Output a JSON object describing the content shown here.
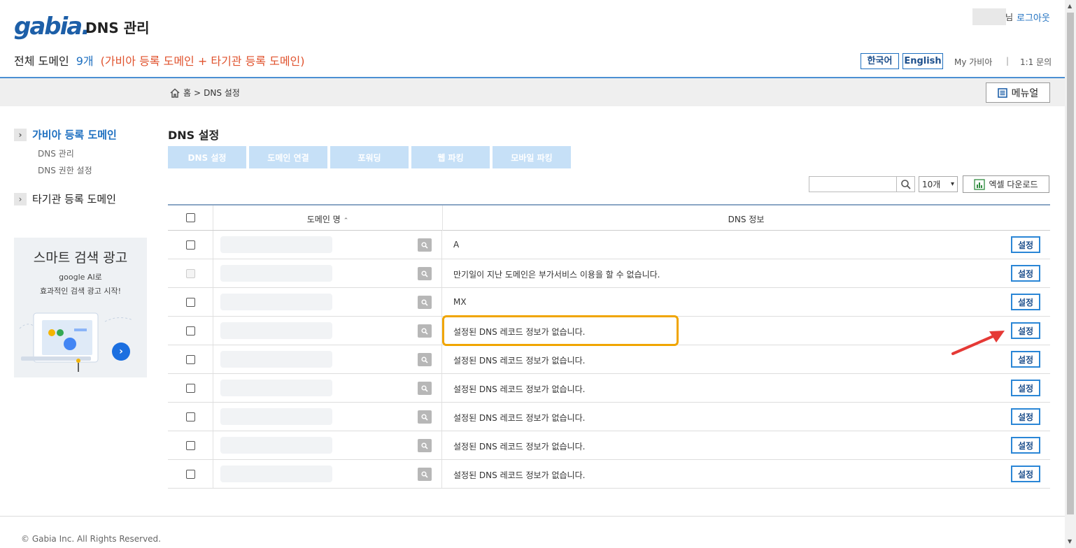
{
  "header": {
    "logo": "gabia.",
    "title": "DNS 관리",
    "user_suffix": "님",
    "logout": "로그아웃",
    "summary_label": "전체 도메인",
    "summary_count": "9개",
    "summary_note": "(가비아 등록 도메인 + 타기관 등록 도메인)",
    "lang_ko": "한국어",
    "lang_en": "English",
    "my_gabia": "My 가비아",
    "separator": "|",
    "inquiry": "1:1 문의"
  },
  "breadcrumb": {
    "home": "홈",
    "arrow": ">",
    "current": "DNS 설정"
  },
  "manual_label": "메뉴얼",
  "sidebar": {
    "groups": [
      {
        "label": "가비아 등록 도메인",
        "items": [
          "DNS 관리",
          "DNS 권한 설정"
        ]
      },
      {
        "label": "타기관 등록 도메인",
        "items": []
      }
    ],
    "ad": {
      "title": "스마트 검색 광고",
      "line1": "google AI로",
      "line2": "효과적인 검색 광고 시작!"
    }
  },
  "content": {
    "title": "DNS 설정",
    "tabs": [
      "DNS 설정",
      "도메인 연결",
      "포워딩",
      "웹 파킹",
      "모바일 파킹"
    ],
    "page_size": "10개",
    "excel": "엑셀 다운로드",
    "columns": {
      "name": "도메인 명",
      "dns": "DNS 정보"
    },
    "set_label": "설정",
    "rows": [
      {
        "dns": "A",
        "disabled": false
      },
      {
        "dns": "만기일이 지난 도메인은 부가서비스 이용을 할 수 없습니다.",
        "disabled": true
      },
      {
        "dns": "MX",
        "disabled": false
      },
      {
        "dns": "설정된 DNS 레코드 정보가 없습니다.",
        "disabled": false
      },
      {
        "dns": "설정된 DNS 레코드 정보가 없습니다.",
        "disabled": false
      },
      {
        "dns": "설정된 DNS 레코드 정보가 없습니다.",
        "disabled": false
      },
      {
        "dns": "설정된 DNS 레코드 정보가 없습니다.",
        "disabled": false
      },
      {
        "dns": "설정된 DNS 레코드 정보가 없습니다.",
        "disabled": false
      },
      {
        "dns": "설정된 DNS 레코드 정보가 없습니다.",
        "disabled": false
      }
    ]
  },
  "footer": {
    "copyright": "© Gabia Inc. All Rights Reserved."
  },
  "colors": {
    "brand": "#1d5fa8",
    "accent": "#2a86d6",
    "note": "#e0522d",
    "highlight": "#f0a500",
    "arrow": "#e53935"
  }
}
